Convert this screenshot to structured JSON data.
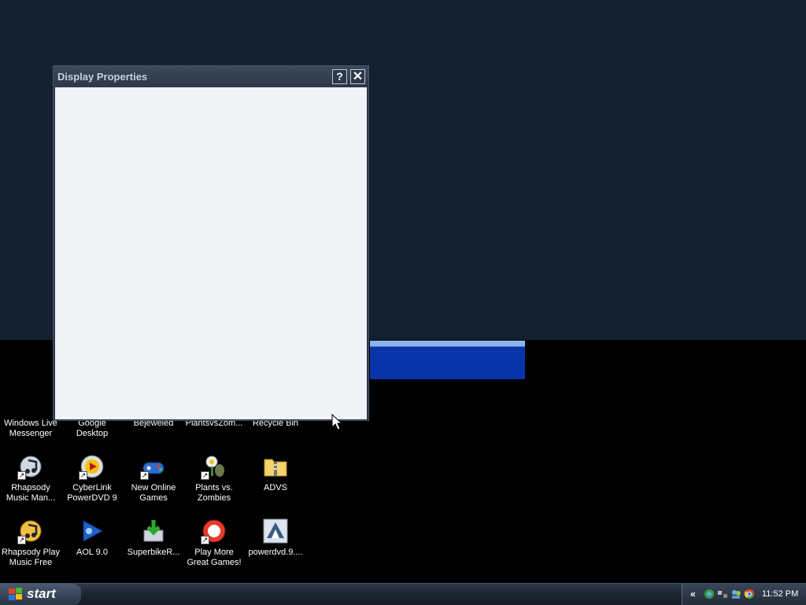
{
  "window": {
    "title": "Display Properties",
    "help_label": "?",
    "close_label": "✕"
  },
  "desktop": {
    "row1_labels": [
      "Windows Live\nMessenger",
      "Google\nDesktop",
      "Bejeweled",
      "PlantsvsZom...",
      "Recycle Bin"
    ],
    "icons_row2": [
      {
        "label": "Rhapsody Music Man...",
        "icon": "rhapsody-icon"
      },
      {
        "label": "CyberLink PowerDVD 9",
        "icon": "powerdvd-icon"
      },
      {
        "label": "New Online Games",
        "icon": "gamepad-icon"
      },
      {
        "label": "Plants vs. Zombies",
        "icon": "plant-icon"
      },
      {
        "label": "ADVS",
        "icon": "zip-folder-icon"
      }
    ],
    "icons_row3": [
      {
        "label": "Rhapsody Play Music Free",
        "icon": "rhapsody-icon"
      },
      {
        "label": "AOL 9.0",
        "icon": "aol-icon"
      },
      {
        "label": "SuperbikeR...",
        "icon": "installer-icon"
      },
      {
        "label": "Play More Great Games!",
        "icon": "popcap-icon"
      },
      {
        "label": "powerdvd.9....",
        "icon": "disc-image-icon"
      }
    ]
  },
  "taskbar": {
    "start_label": "start",
    "tray_chevron": "«",
    "clock": "11:52 PM"
  },
  "colors": {
    "desktop_top": "#14202f",
    "strip_blue": "#0633a8",
    "dialog_client": "#f1f3f6"
  }
}
